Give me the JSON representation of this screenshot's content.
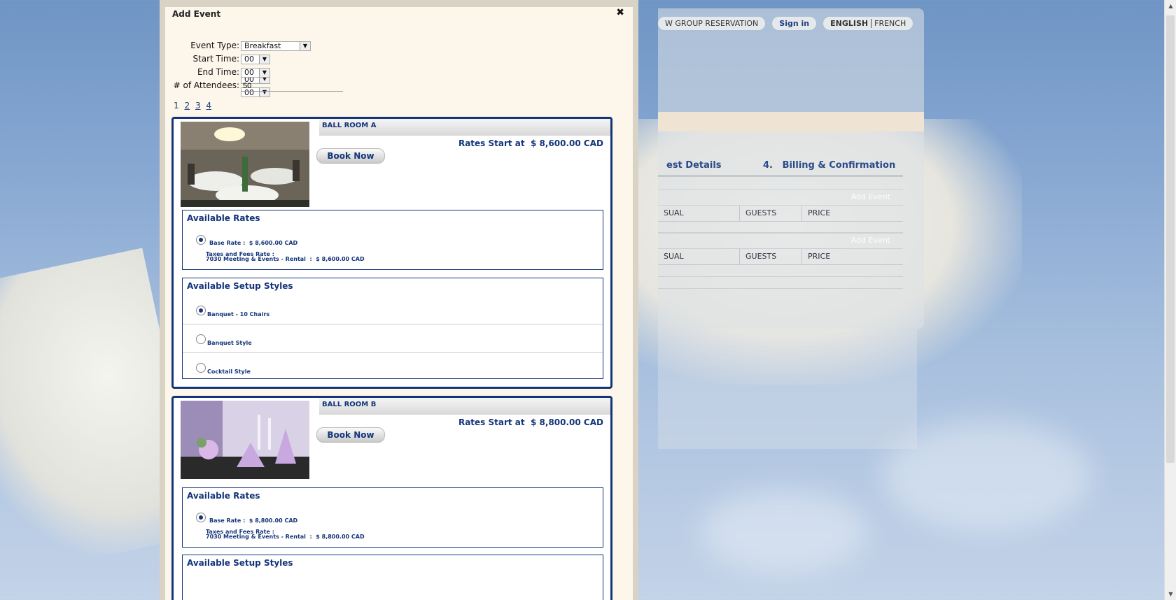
{
  "background": {
    "nav": {
      "group_reservation": "W GROUP RESERVATION",
      "sign_in": "Sign in",
      "lang_english": "ENGLISH",
      "lang_french": "FRENCH"
    },
    "steps": {
      "step3_partial": "est Details",
      "step4_number": "4.",
      "step4_label": "Billing & Confirmation"
    },
    "events": [
      {
        "add_label": "Add Event",
        "col_visual": "SUAL",
        "col_guests": "GUESTS",
        "col_price": "PRICE"
      },
      {
        "add_label": "Add Event",
        "col_visual": "SUAL",
        "col_guests": "GUESTS",
        "col_price": "PRICE"
      }
    ]
  },
  "modal": {
    "title": "Add Event",
    "close_glyph": "✖",
    "form": {
      "event_type_label": "Event Type:",
      "event_type_value": "Breakfast",
      "start_time_label": "Start Time:",
      "start_hour": "00",
      "start_min": "00",
      "end_time_label": "End Time:",
      "end_hour": "00",
      "end_min": "00",
      "dash": "-",
      "attendees_label": "# of Attendees:",
      "attendees_value": "50"
    },
    "pager": [
      "1",
      "2",
      "3",
      "4"
    ],
    "rooms": [
      {
        "name": "BALL ROOM A",
        "book_label": "Book Now",
        "rates_start_label": "Rates Start at",
        "rates_start_value": "$ 8,600.00 CAD",
        "available_rates_title": "Available Rates",
        "base_rate_label": "Base Rate :",
        "base_rate_value": "$ 8,600.00 CAD",
        "taxes_label": "Taxes and Fees Rate :",
        "tax_line_label": "7030 Meeting & Events - Rental",
        "tax_line_sep": ":",
        "tax_line_value": "$ 8,600.00 CAD",
        "setup_title": "Available Setup Styles",
        "setups": [
          "Banquet - 10 Chairs",
          "Banquet Style",
          "Cocktail Style"
        ]
      },
      {
        "name": "BALL ROOM B",
        "book_label": "Book Now",
        "rates_start_label": "Rates Start at",
        "rates_start_value": "$ 8,800.00 CAD",
        "available_rates_title": "Available Rates",
        "base_rate_label": "Base Rate :",
        "base_rate_value": "$ 8,800.00 CAD",
        "taxes_label": "Taxes and Fees Rate :",
        "tax_line_label": "7030 Meeting & Events - Rental",
        "tax_line_sep": ":",
        "tax_line_value": "$ 8,800.00 CAD",
        "setup_title": "Available Setup Styles"
      }
    ]
  }
}
